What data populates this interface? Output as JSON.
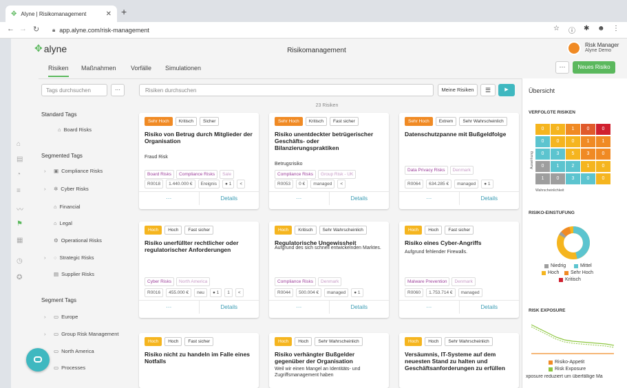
{
  "browser": {
    "tab_title": "Alyne | Risikomanagement",
    "url": "app.alyne.com/risk-management"
  },
  "app": {
    "logo": "alyne",
    "title": "Risikomanagement",
    "user_role": "Risk Manager",
    "user_name": "Alyne Demo",
    "more_label": "···",
    "new_risk_label": "Neues Risiko"
  },
  "nav_tabs": [
    {
      "label": "Risiken",
      "active": true
    },
    {
      "label": "Maßnahmen"
    },
    {
      "label": "Vorfälle"
    },
    {
      "label": "Simulationen"
    }
  ],
  "tags": {
    "search_placeholder": "Tags durchsuchen",
    "more_label": "···",
    "standard_title": "Standard Tags",
    "standard": [
      "Board Risks"
    ],
    "segmented_title": "Segmented Tags",
    "segmented": [
      "Compliance Risks",
      "Cyber Risks",
      "Financial",
      "Legal",
      "Operational Risks",
      "Strategic Risks",
      "Supplier Risks"
    ],
    "segment_title": "Segment Tags",
    "segment": [
      "Europe",
      "Group Risk Management",
      "North America",
      "Processes"
    ]
  },
  "search": {
    "placeholder": "Risiken durchsuchen",
    "my_risks": "Meine Risiken",
    "count": "23 Risiken"
  },
  "cards": [
    {
      "badges": [
        "Sehr Hoch",
        "Kritisch",
        "Sicher"
      ],
      "title": "Risiko von Betrug durch Mitglieder der Organisation",
      "sub": "Fraud Risk",
      "chips": [
        "Board Risks",
        "Compliance Risks",
        "Sale"
      ],
      "meta": [
        "R0018",
        "1.440.000 €",
        "Ereignis",
        "● 1",
        "<"
      ],
      "more": "···",
      "details": "Details"
    },
    {
      "badges": [
        "Sehr Hoch",
        "Kritisch",
        "Fast sicher"
      ],
      "title": "Risiko unentdeckter betrügerischer Geschäfts- oder Bilanzierungspraktiken",
      "sub": "Betrugsrisiko",
      "chips": [
        "Compliance Risks",
        "Group Risk - UK"
      ],
      "meta": [
        "R0053",
        "0 €",
        "managed",
        "<"
      ],
      "more": "···",
      "details": "Details"
    },
    {
      "badges": [
        "Sehr Hoch",
        "Extrem",
        "Sehr Wahrscheinlich"
      ],
      "title": "Datenschutzpanne mit Bußgeldfolge",
      "sub": "",
      "chips": [
        "Data Privacy Risks",
        "Denmark"
      ],
      "meta": [
        "R0064",
        "634.285 €",
        "managed",
        "● 1"
      ],
      "more": "···",
      "details": "Details"
    },
    {
      "badges": [
        "Hoch",
        "Hoch",
        "Fast sicher"
      ],
      "title": "Risiko unerfüllter rechtlicher oder regulatorischer Anforderungen",
      "sub": "",
      "chips": [
        "Cyber Risks",
        "North America"
      ],
      "meta": [
        "R0016",
        "455.000 €",
        "neu",
        "● 1",
        "1",
        "<"
      ],
      "more": "···",
      "details": "Details"
    },
    {
      "badges": [
        "Hoch",
        "Kritisch",
        "Sehr Wahrscheinlich"
      ],
      "title": "Regulatorische Ungewissheit",
      "sub": "Aufgrund des sich schnell entwickelnden Marktes.",
      "chips": [
        "Compliance Risks",
        "Denmark"
      ],
      "meta": [
        "R0044",
        "500.004 €",
        "managed",
        "● 1"
      ],
      "more": "···",
      "details": "Details"
    },
    {
      "badges": [
        "Hoch",
        "Hoch",
        "Fast sicher"
      ],
      "title": "Risiko eines Cyber-Angriffs",
      "sub": "Aufgrund fehlender Firewalls.",
      "chips": [
        "Malware Prevention",
        "Denmark"
      ],
      "meta": [
        "R0060",
        "1.753.714 €",
        "managed"
      ],
      "more": "···",
      "details": "Details"
    },
    {
      "badges": [
        "Hoch",
        "Hoch",
        "Fast sicher"
      ],
      "title": "Risiko nicht zu handeln im Falle eines Notfalls",
      "sub": "",
      "chips": [],
      "meta": [],
      "more": "",
      "details": ""
    },
    {
      "badges": [
        "Hoch",
        "Hoch",
        "Sehr Wahrscheinlich"
      ],
      "title": "Risiko verhängter Bußgelder gegenüber der Organisation",
      "sub": "Weil wir einen Mangel an Identitäts- und Zugriffsmanagement haben",
      "chips": [],
      "meta": [],
      "more": "",
      "details": ""
    },
    {
      "badges": [
        "Hoch",
        "Hoch",
        "Sehr Wahrscheinlich"
      ],
      "title": "Versäumnis, IT-Systeme auf dem neuesten Stand zu halten und Geschäftsanforderungen zu erfüllen",
      "sub": "",
      "chips": [],
      "meta": [],
      "more": "",
      "details": ""
    }
  ],
  "overview": {
    "title": "Übersicht",
    "tracked_title": "VERFOLGTE RISIKEN",
    "heatmap": [
      [
        "0",
        "0",
        "1",
        "0",
        "0"
      ],
      [
        "0",
        "0",
        "0",
        "1",
        "1"
      ],
      [
        "0",
        "3",
        "5",
        "3",
        "0"
      ],
      [
        "0",
        "1",
        "2",
        "1",
        "0"
      ],
      [
        "1",
        "0",
        "3",
        "0",
        "0"
      ]
    ],
    "heat_colors": [
      [
        "#f5b51f",
        "#f5b51f",
        "#f08a24",
        "#e05a2b",
        "#d0202f"
      ],
      [
        "#5cc4cf",
        "#f5b51f",
        "#f5b51f",
        "#f08a24",
        "#f08a24"
      ],
      [
        "#5cc4cf",
        "#5cc4cf",
        "#f5b51f",
        "#f08a24",
        "#f08a24"
      ],
      [
        "#9e9e9e",
        "#5cc4cf",
        "#5cc4cf",
        "#f5b51f",
        "#f5b51f"
      ],
      [
        "#9e9e9e",
        "#9e9e9e",
        "#5cc4cf",
        "#5cc4cf",
        "#f5b51f"
      ]
    ],
    "y_axis": "Auswirkung",
    "x_axis": "Wahrscheinlichkeit",
    "rating_title": "RISIKO-EINSTUFUNG",
    "rating_legend": [
      {
        "label": "Niedrig",
        "color": "#9e9e9e"
      },
      {
        "label": "Mittel",
        "color": "#5cc4cf"
      },
      {
        "label": "Hoch",
        "color": "#f5b51f"
      },
      {
        "label": "Sehr Hoch",
        "color": "#f08a24"
      },
      {
        "label": "Kritisch",
        "color": "#d0202f"
      }
    ],
    "exposure_title": "RISK EXPOSURE",
    "exposure_legend": [
      {
        "label": "Risiko-Appetit",
        "color": "#f08a24"
      },
      {
        "label": "Risk Exposure",
        "color": "#8dc63f"
      }
    ],
    "exposure_note": "xposure reduziert um überfällige Ma"
  }
}
